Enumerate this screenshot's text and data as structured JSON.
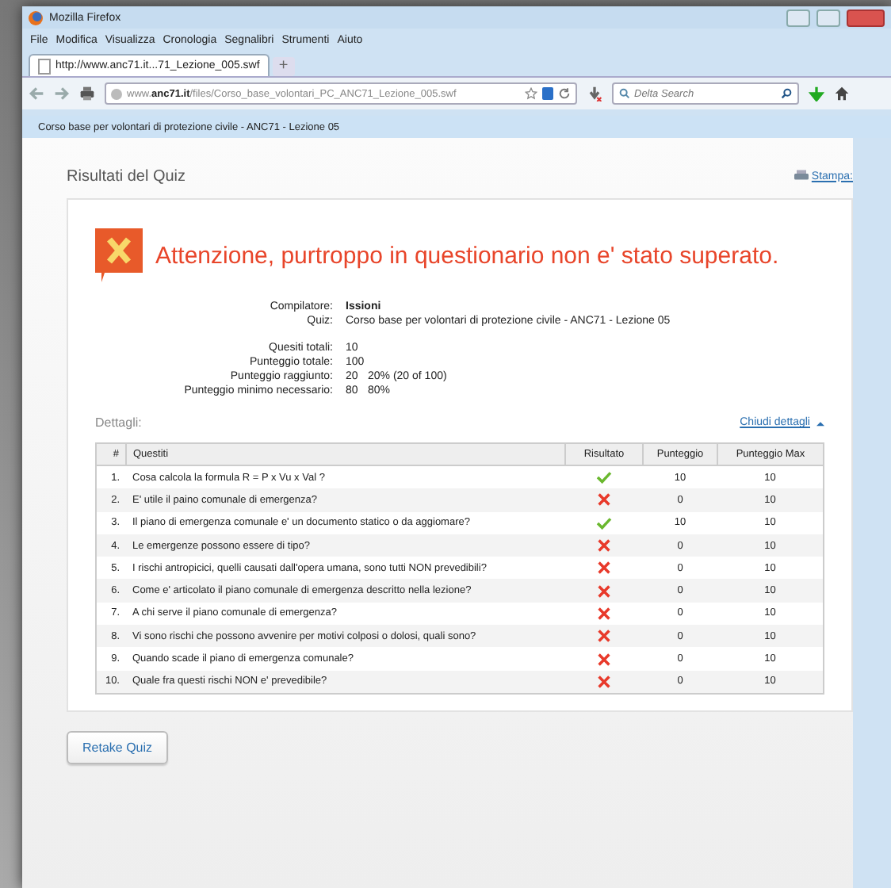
{
  "window": {
    "title": "Mozilla Firefox"
  },
  "menu": [
    "File",
    "Modifica",
    "Visualizza",
    "Cronologia",
    "Segnalibri",
    "Strumenti",
    "Aiuto"
  ],
  "tabs": [
    {
      "label": "http://www.anc71.it...71_Lezione_005.swf",
      "selected": true
    }
  ],
  "new_tab": "+",
  "address_bar": {
    "url": "www.**anc71.it**/files/Corso_base_volontari_PC_ANC71_Lezione_005.swf"
  },
  "search": {
    "placeholder": "Delta Search"
  },
  "page_header": "Corso base per volontari di protezione civile - ANC71 - Lezione 05",
  "page": {
    "title": "Risultati del Quiz",
    "print_link": "Stampa:",
    "alert": "Attenzione, purtroppo in questionario non e' stato superato.",
    "summary": [
      [
        {
          "label": "Compilatore:",
          "value": "Issioni",
          "bold": true
        },
        {
          "label": "Quiz:",
          "value": "Corso base per volontari di protezione civile - ANC71 - Lezione 05",
          "bold": false
        }
      ],
      [
        {
          "label": "Quesiti totali:",
          "value": "10",
          "bold": false
        },
        {
          "label": "Punteggio totale:",
          "value": "100",
          "bold": false
        },
        {
          "label": "Punteggio raggiunto:",
          "value": "20",
          "extra": "20% (20 of 100)",
          "bold": false
        },
        {
          "label": "Punteggio minimo necessario:",
          "value": "80",
          "extra": "80%",
          "bold": false
        }
      ]
    ],
    "details_label": "Dettagli:",
    "toggle_link": "Chiudi dettagli",
    "table": {
      "columns": [
        "#",
        "Questiti",
        "Risultato",
        "Punteggio",
        "Punteggio Max"
      ],
      "rows": [
        {
          "number": "1.",
          "question": "Cosa calcola la formula  R = P x Vu x Val ?",
          "correct": true,
          "score": "10",
          "max": "10"
        },
        {
          "number": "2.",
          "question": "E' utile il paino comunale di emergenza?",
          "correct": false,
          "score": "0",
          "max": "10"
        },
        {
          "number": "3.",
          "question": "Il piano di emergenza comunale e' un documento statico o da aggiomare?",
          "correct": true,
          "score": "10",
          "max": "10"
        },
        {
          "number": "4.",
          "question": "Le emergenze possono essere di tipo?",
          "correct": false,
          "score": "0",
          "max": "10"
        },
        {
          "number": "5.",
          "question": "I rischi antropicici, quelli causati dall'opera umana, sono tutti NON prevedibili?",
          "correct": false,
          "score": "0",
          "max": "10"
        },
        {
          "number": "6.",
          "question": "Come e' articolato il piano comunale di emergenza descritto nella lezione?",
          "correct": false,
          "score": "0",
          "max": "10"
        },
        {
          "number": "7.",
          "question": "A chi serve il piano comunale di emergenza?",
          "correct": false,
          "score": "0",
          "max": "10"
        },
        {
          "number": "8.",
          "question": "Vi sono rischi che possono avvenire per motivi colposi o dolosi, quali sono?",
          "correct": false,
          "score": "0",
          "max": "10"
        },
        {
          "number": "9.",
          "question": "Quando scade il piano di emergenza comunale?",
          "correct": false,
          "score": "0",
          "max": "10"
        },
        {
          "number": "10.",
          "question": "Quale fra questi rischi NON e' prevedibile?",
          "correct": false,
          "score": "0",
          "max": "10"
        }
      ]
    },
    "retake_button": "Retake Quiz"
  }
}
